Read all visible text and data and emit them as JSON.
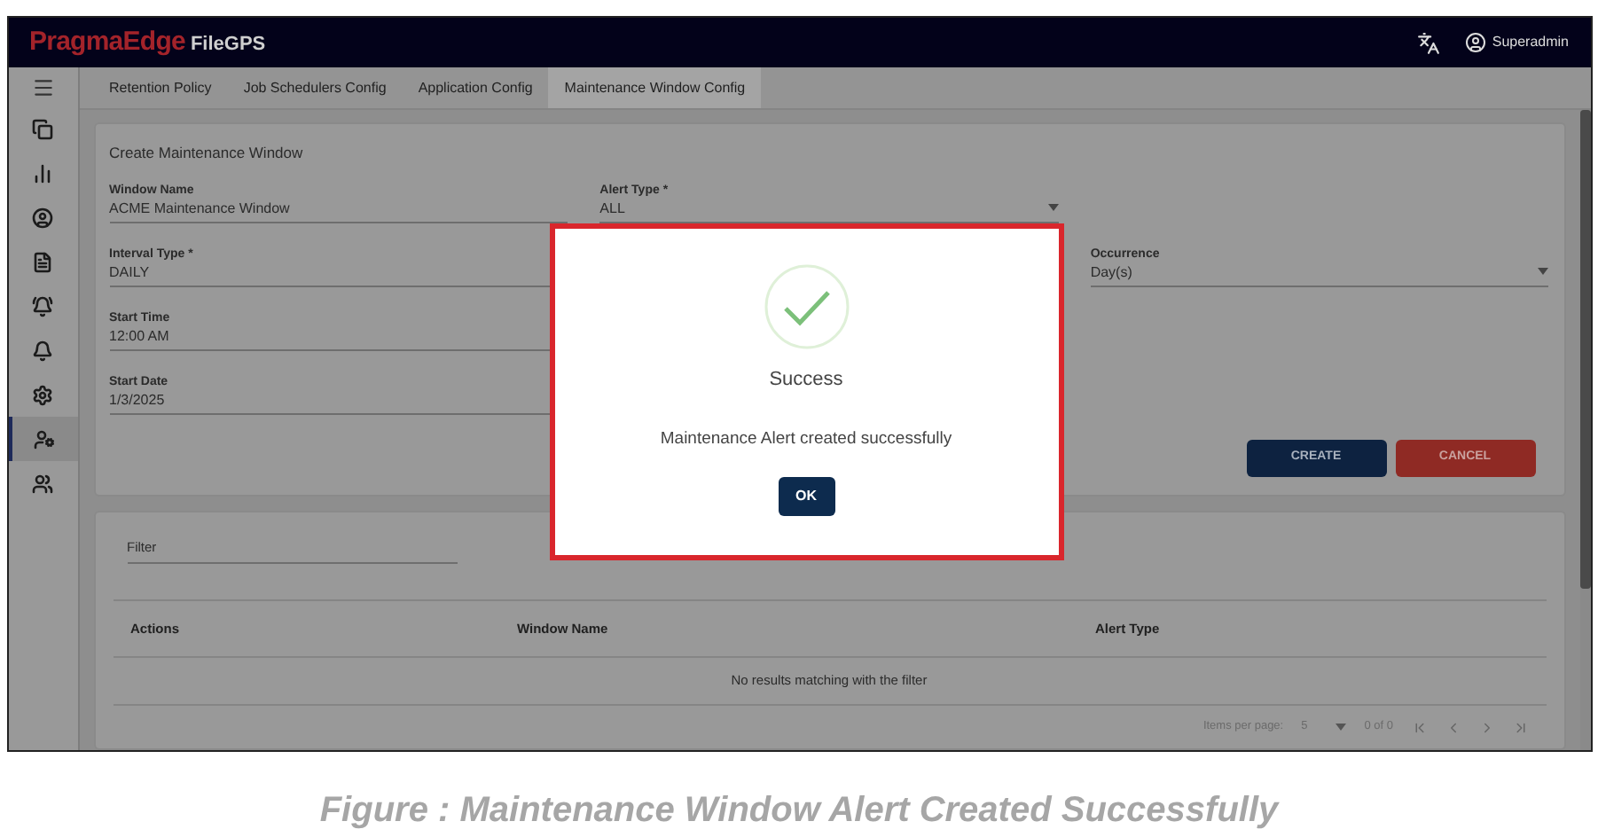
{
  "header": {
    "brand_part_1": "PragmaEdge",
    "brand_part_2": "FileGPS",
    "user": "Superadmin"
  },
  "sidebar": {
    "items": [
      {
        "selected": false
      },
      {
        "selected": false
      },
      {
        "selected": false
      },
      {
        "selected": false
      },
      {
        "selected": false
      },
      {
        "selected": false
      },
      {
        "selected": false
      },
      {
        "selected": true
      },
      {
        "selected": false
      }
    ]
  },
  "tabs": [
    {
      "label": "Retention Policy",
      "selected": false
    },
    {
      "label": "Job Schedulers Config",
      "selected": false
    },
    {
      "label": "Application Config",
      "selected": false
    },
    {
      "label": "Maintenance Window Config",
      "selected": true
    }
  ],
  "form": {
    "title": "Create Maintenance Window",
    "fields": [
      {
        "label": "Window Name",
        "value": "ACME Maintenance Window",
        "kind": "text"
      },
      {
        "label": "Alert Type *",
        "value": "ALL",
        "kind": "select"
      },
      {
        "label": "Interval Type *",
        "value": "DAILY",
        "kind": "text"
      },
      {
        "label": "Occurrence",
        "value": "Day(s)",
        "kind": "select"
      },
      {
        "label": "Start Time",
        "value": "12:00 AM",
        "kind": "text"
      },
      {
        "label": "Start Date",
        "value": "1/3/2025",
        "kind": "text"
      }
    ],
    "buttons": [
      {
        "label": "CREATE",
        "kind": "primary"
      },
      {
        "label": "CANCEL",
        "kind": "danger"
      }
    ]
  },
  "table": {
    "filter": {
      "placeholder": "Filter"
    },
    "columns": [
      "Actions",
      "Window Name",
      "Alert Type"
    ],
    "empty_message": "No results matching with the filter",
    "paginator": {
      "items_per_page_label": "Items per page:",
      "items_per_page": "5",
      "range": "0 of 0"
    }
  },
  "dialog": {
    "title": "Success",
    "message": "Maintenance Alert created successfully",
    "button": "OK"
  },
  "caption": "Figure : Maintenance Window Alert Created Successfully"
}
